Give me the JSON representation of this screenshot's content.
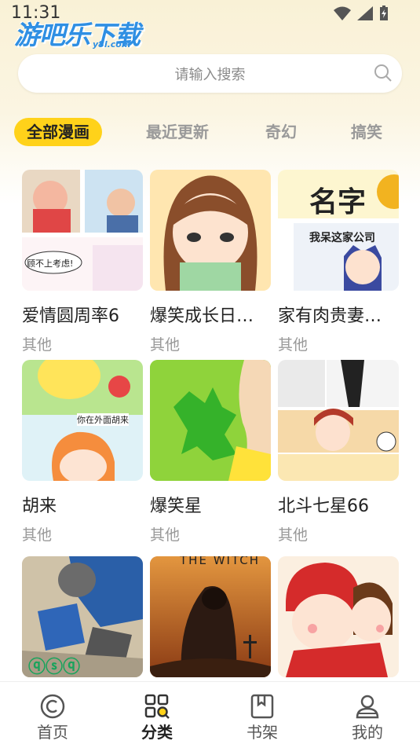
{
  "status": {
    "time": "11:31"
  },
  "logo": {
    "text": "游吧乐下载",
    "sub": "y8l.com"
  },
  "search": {
    "placeholder": "请输入搜索"
  },
  "tabs": [
    {
      "label": "全部漫画",
      "active": true
    },
    {
      "label": "最近更新",
      "active": false
    },
    {
      "label": "奇幻",
      "active": false
    },
    {
      "label": "搞笑",
      "active": false
    }
  ],
  "comics": [
    {
      "title": "爱情圆周率6",
      "genre": "其他",
      "cover_text": "顾不上考虑!"
    },
    {
      "title": "爆笑成长日…",
      "genre": "其他"
    },
    {
      "title": "家有肉贵妻…",
      "genre": "其他",
      "cover_text": "名字",
      "cover_text2": "我呆这家公司"
    },
    {
      "title": "胡来",
      "genre": "其他",
      "cover_text": "你在外面胡来"
    },
    {
      "title": "爆笑星",
      "genre": "其他"
    },
    {
      "title": "北斗七星66",
      "genre": "其他"
    },
    {
      "title": "",
      "genre": ""
    },
    {
      "title": "",
      "genre": "",
      "cover_text": "THE WITCH"
    },
    {
      "title": "",
      "genre": ""
    }
  ],
  "nav": [
    {
      "label": "首页",
      "icon": "home-icon",
      "active": false
    },
    {
      "label": "分类",
      "icon": "category-icon",
      "active": true
    },
    {
      "label": "书架",
      "icon": "bookshelf-icon",
      "active": false
    },
    {
      "label": "我的",
      "icon": "profile-icon",
      "active": false
    }
  ],
  "colors": {
    "accent": "#ffd21a",
    "logo": "#2f8fe3"
  }
}
